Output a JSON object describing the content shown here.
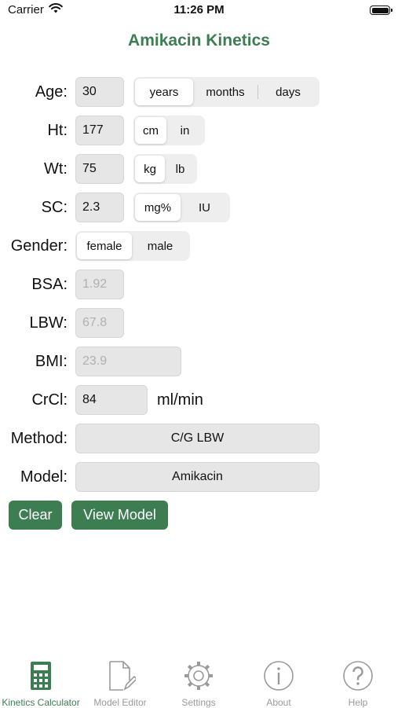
{
  "status": {
    "carrier": "Carrier",
    "time": "11:26 PM"
  },
  "title": "Amikacin Kinetics",
  "age": {
    "label": "Age:",
    "value": "30",
    "units": [
      "years",
      "months",
      "days"
    ],
    "selected": "years"
  },
  "ht": {
    "label": "Ht:",
    "value": "177",
    "units": [
      "cm",
      "in"
    ],
    "selected": "cm"
  },
  "wt": {
    "label": "Wt:",
    "value": "75",
    "units": [
      "kg",
      "lb"
    ],
    "selected": "kg"
  },
  "sc": {
    "label": "SC:",
    "value": "2.3",
    "units": [
      "mg%",
      "IU"
    ],
    "selected": "mg%"
  },
  "gender": {
    "label": "Gender:",
    "options": [
      "female",
      "male"
    ],
    "selected": "female"
  },
  "bsa": {
    "label": "BSA:",
    "value": "1.92"
  },
  "lbw": {
    "label": "LBW:",
    "value": "67.8"
  },
  "bmi": {
    "label": "BMI:",
    "value": "23.9"
  },
  "crcl": {
    "label": "CrCl:",
    "value": "84",
    "unit": "ml/min"
  },
  "method": {
    "label": "Method:",
    "value": "C/G LBW"
  },
  "model": {
    "label": "Model:",
    "value": "Amikacin"
  },
  "buttons": {
    "clear": "Clear",
    "view_model": "View Model"
  },
  "tabs": [
    {
      "label": "Kinetics Calculator",
      "icon": "calculator-icon",
      "active": true
    },
    {
      "label": "Model Editor",
      "icon": "document-edit-icon",
      "active": false
    },
    {
      "label": "Settings",
      "icon": "gear-icon",
      "active": false
    },
    {
      "label": "About",
      "icon": "info-icon",
      "active": false
    },
    {
      "label": "Help",
      "icon": "question-icon",
      "active": false
    }
  ],
  "colors": {
    "accent": "#3d7d52",
    "field_bg": "#e6e6e6",
    "inactive_tab": "#9a9a9a"
  }
}
